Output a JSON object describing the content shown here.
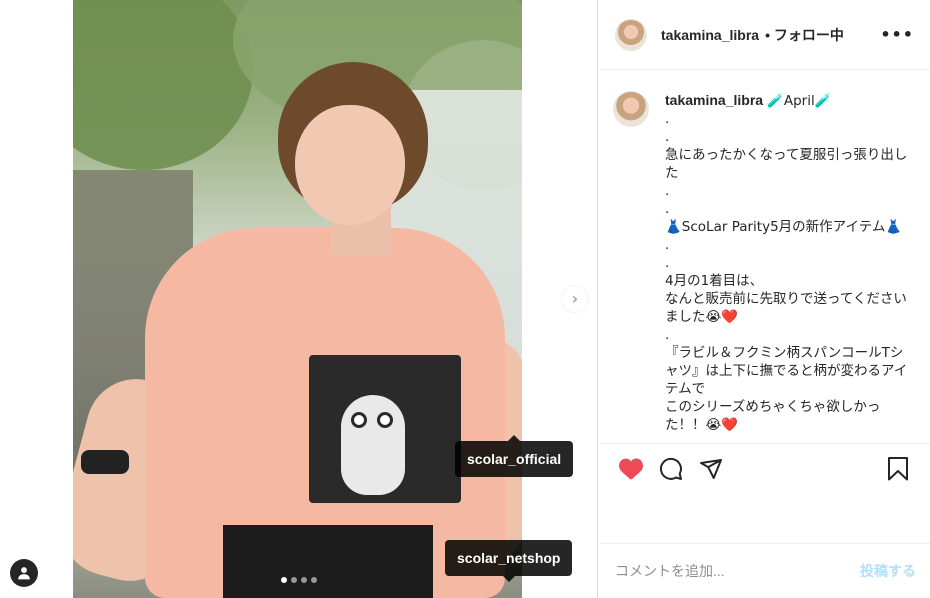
{
  "colors": {
    "accent_blue_disabled": "#b2dffc",
    "like_red": "#ed4956",
    "text": "#262626",
    "muted": "#8e8e8e",
    "tag_bg": "#000000",
    "shirt": "#f4b8a3"
  },
  "media": {
    "next_button_icon": "chevron-right-icon",
    "carousel": {
      "count": 4,
      "active_index": 0
    },
    "tags": [
      {
        "label": "scolar_official"
      },
      {
        "label": "scolar_netshop"
      }
    ],
    "user_tag_icon": "person-icon"
  },
  "header": {
    "username": "takamina_libra",
    "follow_status": "• フォロー中",
    "more_icon": "more-dots-icon",
    "more_label": "•••"
  },
  "caption": {
    "username": "takamina_libra",
    "lines": [
      "🧪April🧪",
      ".",
      ".",
      "急にあったかくなって夏服引っ張り出した",
      ".",
      ".",
      "👗ScoLar Parity5月の新作アイテム👗",
      ".",
      ".",
      "4月の1着目は、",
      "なんと販売前に先取りで送ってくださいました😭❤️",
      ".",
      "『ラビル＆フクミン柄スパンコールTシャツ』は上下に撫でると柄が変わるアイテムで",
      "このシリーズめちゃくちゃ欲しかった！！😭❤️"
    ]
  },
  "actions": {
    "like_icon": "heart-filled-icon",
    "comment_icon": "comment-bubble-icon",
    "share_icon": "paper-plane-icon",
    "save_icon": "bookmark-icon"
  },
  "add_comment": {
    "placeholder": "コメントを追加...",
    "post_label": "投稿する"
  }
}
